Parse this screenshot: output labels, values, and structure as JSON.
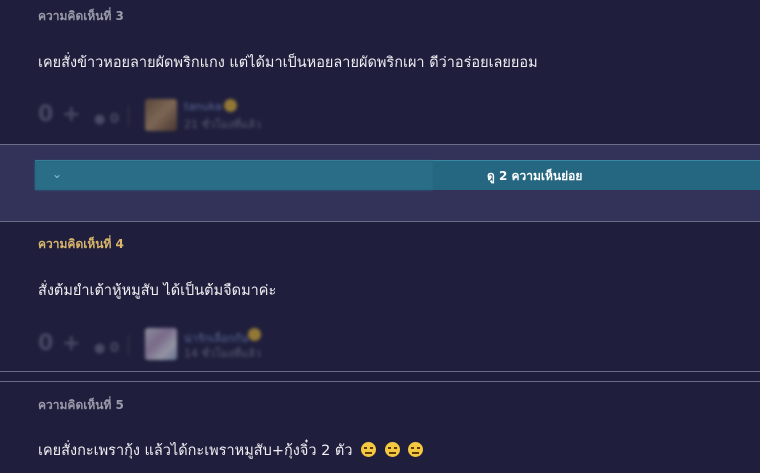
{
  "comments": [
    {
      "label": "ความคิดเห็นที่ 3",
      "text": "เคยสั่งข้าวหอยลายผัดพริกแกง แต่ได้มาเป็นหอยลายผัดพริกเผา ดีว่าอร่อยเลยยอม",
      "user": {
        "name": "tanuka",
        "meta": "21 ชั่วโมงที่แล้ว"
      },
      "votes": "0",
      "emotion": "0"
    },
    {
      "label": "ความคิดเห็นที่ 4",
      "text": "สั่งต้มยำเต้าหู้หมูสับ ได้เป็นต้มจืดมาค่ะ",
      "user": {
        "name": "น่ารักเลื่อกกัน",
        "meta": "14 ชั่วโมงที่แล้ว"
      },
      "votes": "0",
      "emotion": "0"
    },
    {
      "label": "ความคิดเห็นที่ 5",
      "text": "เคยสั่งกะเพรากุ้ง แล้วได้กะเพราหมูสับ+กุ้งจิ๋ว 2 ตัว",
      "emoji_count": 3,
      "emoji_icon": "unamused-face-icon"
    }
  ],
  "replies": {
    "toggle_icon": "chevron-down-icon",
    "label": "ดู 2 ความเห็นย่อย"
  },
  "colors": {
    "background": "#1f1f3d",
    "reply_zone": "#33335a",
    "reply_bar": "#256680",
    "label_gold": "#d9b56a"
  }
}
